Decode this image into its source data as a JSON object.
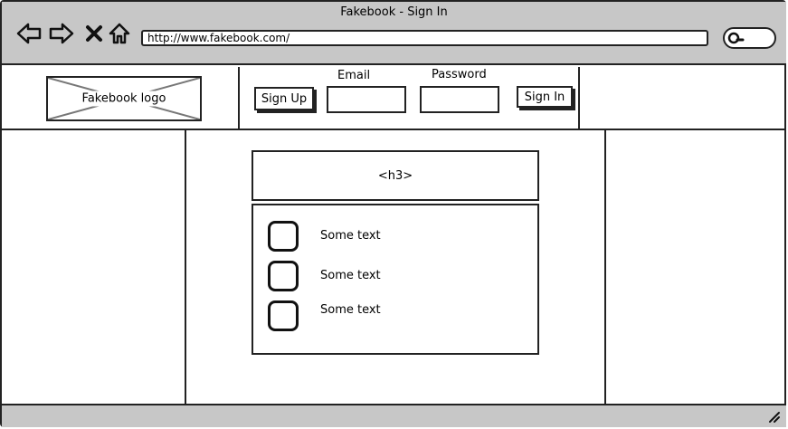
{
  "window": {
    "title": "Fakebook - Sign In"
  },
  "toolbar": {
    "url": "http://www.fakebook.com/",
    "icons": [
      "back-arrow-icon",
      "forward-arrow-icon",
      "close-x-icon",
      "home-icon",
      "search-icon"
    ]
  },
  "header": {
    "logo_label": "Fakebook logo",
    "signup_label": "Sign Up",
    "email_label": "Email",
    "password_label": "Password",
    "signin_label": "Sign In"
  },
  "main": {
    "heading_placeholder": "<h3>",
    "items": [
      {
        "text": "Some text"
      },
      {
        "text": "Some text"
      },
      {
        "text": "Some text"
      }
    ]
  },
  "colors": {
    "chrome": "#c7c7c7",
    "stroke": "#222222",
    "background": "#ffffff"
  }
}
